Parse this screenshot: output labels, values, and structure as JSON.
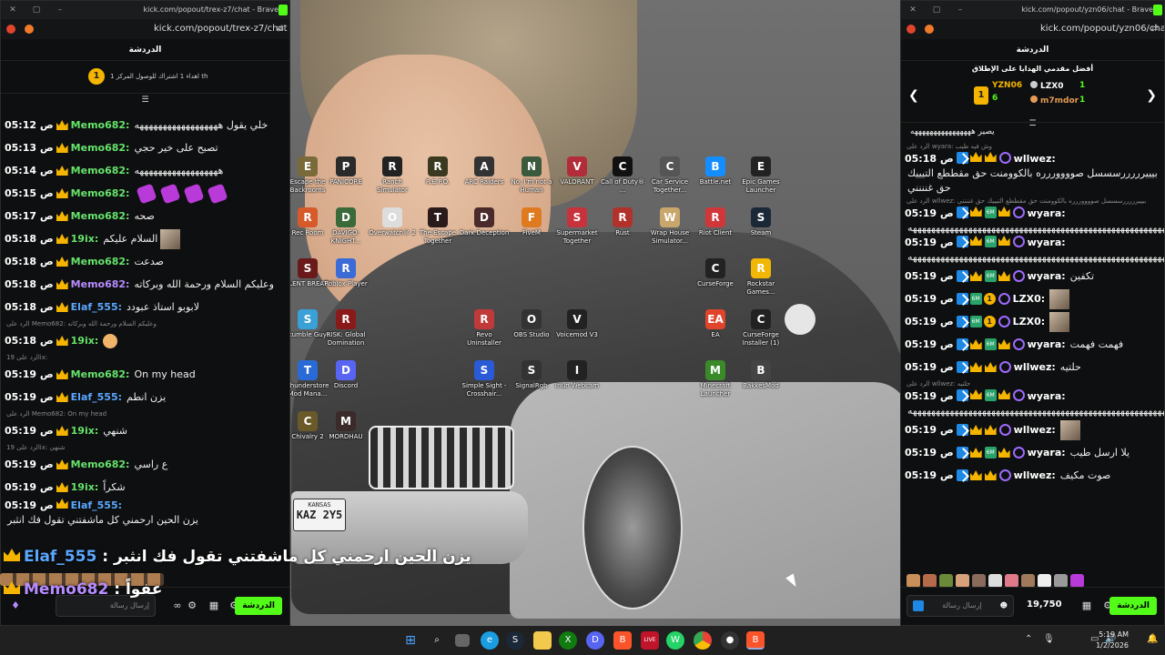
{
  "desktop": {
    "plate_state": "KANSAS",
    "plate_number": "KAZ 2Y5",
    "icons": [
      {
        "label": "Escape the Backrooms",
        "color": "#7a6a3a",
        "glyph": "E"
      },
      {
        "label": "PANICORE",
        "color": "#2a2a2a",
        "glyph": "P"
      },
      {
        "label": "Ranch Simulator",
        "color": "#222",
        "glyph": "R"
      },
      {
        "label": "R.E.P.O.",
        "color": "#3a3a20",
        "glyph": "R"
      },
      {
        "label": "ARC Raiders",
        "color": "#333",
        "glyph": "A"
      },
      {
        "label": "No, I'm not a Human",
        "color": "#3b5a3b",
        "glyph": "N"
      },
      {
        "label": "VALORANT",
        "color": "#b22d3a",
        "glyph": "V"
      },
      {
        "label": "Call of Duty® ...",
        "color": "#111",
        "glyph": "C"
      },
      {
        "label": "Car Service Together...",
        "color": "#555",
        "glyph": "C"
      },
      {
        "label": "Battle.net",
        "color": "#148eff",
        "glyph": "B"
      },
      {
        "label": "Epic Games Launcher",
        "color": "#222",
        "glyph": "E"
      },
      {
        "label": "Rec Room",
        "color": "#d65a2a",
        "glyph": "R"
      },
      {
        "label": "DAVIGO: KNIGHT...",
        "color": "#3a6a3a",
        "glyph": "D"
      },
      {
        "label": "Overwatch® 2",
        "color": "#ddd",
        "glyph": "O"
      },
      {
        "label": "The Escape Together",
        "color": "#2a1a1a",
        "glyph": "T"
      },
      {
        "label": "Dark Deception",
        "color": "#4a2a2a",
        "glyph": "D"
      },
      {
        "label": "FiveM",
        "color": "#e07a20",
        "glyph": "F"
      },
      {
        "label": "Supermarket Together",
        "color": "#c8323c",
        "glyph": "S"
      },
      {
        "label": "Rust",
        "color": "#b0322a",
        "glyph": "R"
      },
      {
        "label": "Wrap House Simulator...",
        "color": "#c9a66b",
        "glyph": "W"
      },
      {
        "label": "Riot Client",
        "color": "#d13639",
        "glyph": "R"
      },
      {
        "label": "Steam",
        "color": "#1b2838",
        "glyph": "S"
      },
      {
        "label": "SILENT BREATH",
        "color": "#6a1a1a",
        "glyph": "S"
      },
      {
        "label": "Roblox Player",
        "color": "#3a6bd6",
        "glyph": "R"
      },
      {
        "label": "CurseForge",
        "color": "#222",
        "glyph": "C"
      },
      {
        "label": "Rockstar Games...",
        "color": "#f2b705",
        "glyph": "R"
      },
      {
        "label": "Stumble Guys",
        "color": "#3aa0d6",
        "glyph": "S"
      },
      {
        "label": "RISK: Global Domination",
        "color": "#8a1a1a",
        "glyph": "R"
      },
      {
        "label": "Revo Uninstaller",
        "color": "#c13a3a",
        "glyph": "R"
      },
      {
        "label": "OBS Studio",
        "color": "#333",
        "glyph": "O"
      },
      {
        "label": "Voicemod V3",
        "color": "#222",
        "glyph": "V"
      },
      {
        "label": "EA",
        "color": "#e0442a",
        "glyph": "EA"
      },
      {
        "label": "CurseForge Installer (1)",
        "color": "#222",
        "glyph": "C"
      },
      {
        "label": "Thunderstore Mod Mana...",
        "color": "#2a6ad6",
        "glyph": "T"
      },
      {
        "label": "Discord",
        "color": "#5865f2",
        "glyph": "D"
      },
      {
        "label": "Simple Sight - Crosshair...",
        "color": "#2a5ad6",
        "glyph": "S"
      },
      {
        "label": "SignalRgb",
        "color": "#333",
        "glyph": "S"
      },
      {
        "label": "Iriun Webcam",
        "color": "#222",
        "glyph": "I"
      },
      {
        "label": "Minecraft Launcher",
        "color": "#3a8a2a",
        "glyph": "M"
      },
      {
        "label": "BakkesMod",
        "color": "#444",
        "glyph": "B"
      },
      {
        "label": "Chivalry 2",
        "color": "#6a5a2a",
        "glyph": "C"
      },
      {
        "label": "MORDHAU",
        "color": "#3a2a2a",
        "glyph": "M"
      }
    ]
  },
  "left_window": {
    "title": "kick.com/popout/trex-z7/chat - Brave",
    "url": "kick.com/popout/trex-z7/chat",
    "chat_header": "الدردشة",
    "goal_text": "اهداء 1 اشتراك للوصول المركز 1 th",
    "goal_rank": "1",
    "messages": [
      {
        "time": "05:12 ص",
        "user": "Memo682",
        "text": "خلي يقول ههههههههههههههههههه",
        "color": "memo"
      },
      {
        "time": "05:13 ص",
        "user": "Memo682",
        "text": "تصبح على خير حجي",
        "color": "memo"
      },
      {
        "time": "05:14 ص",
        "user": "Memo682",
        "text": "ههههههههههههههههههه",
        "color": "memo"
      },
      {
        "time": "05:15 ص",
        "user": "Memo682",
        "text": "",
        "color": "memo",
        "emotes": 4
      },
      {
        "time": "05:17 ص",
        "user": "Memo682",
        "text": "صحه",
        "color": "memo"
      },
      {
        "time": "05:18 ص",
        "user": "19ix",
        "text": "السلام عليكم",
        "color": "19ix",
        "avatar": true
      },
      {
        "time": "05:18 ص",
        "user": "Memo682",
        "text": "صدعت",
        "color": "memo"
      },
      {
        "time": "05:18 ص",
        "user": "Memo682",
        "text": "وعليكم السلام ورحمة الله وبركاته",
        "color": "memo-purple"
      },
      {
        "time": "05:18 ص",
        "user": "Elaf_555",
        "text": "لابوبو استاذ عبودد",
        "color": "elaf"
      },
      {
        "reply": "الرد على Memo682: وعليكم السلام ورحمة الله وبركاته"
      },
      {
        "time": "05:18 ص",
        "user": "19ix",
        "text": "",
        "color": "19ix",
        "face": true
      },
      {
        "reply": "الرد على 19ix:"
      },
      {
        "time": "05:19 ص",
        "user": "Memo682",
        "text": "On my head",
        "color": "memo"
      },
      {
        "time": "05:19 ص",
        "user": "Elaf_555",
        "text": "يزن انطم",
        "color": "elaf"
      },
      {
        "reply": "الرد على Memo682: On my head"
      },
      {
        "time": "05:19 ص",
        "user": "19ix",
        "text": "شنهي",
        "color": "19ix"
      },
      {
        "reply": "الرد على 19ix: شنهي"
      },
      {
        "time": "05:19 ص",
        "user": "Memo682",
        "text": "ع راسي",
        "color": "memo"
      },
      {
        "time": "05:19 ص",
        "user": "19ix",
        "text": "شكراً",
        "color": "19ix"
      },
      {
        "time": "05:19 ص",
        "user": "Elaf_555",
        "text": "يزن الحين ارحمني كل ماشفتني تقول فك انثبر",
        "color": "elaf",
        "wrap": true
      }
    ],
    "overlay_line1_user": "Elaf_555",
    "overlay_line1_text": "يزن الحين ارحمني كل ماشفتني تقول فك انثبر",
    "overlay_line2_user": "Memo682",
    "overlay_line2_text": "عفواً",
    "input_placeholder": "إرسال رسالة",
    "send_label": "الدردشة"
  },
  "right_window": {
    "title": "kick.com/popout/yzn06/chat - Brave",
    "url": "kick.com/popout/yzn06/chat",
    "chat_header": "الدردشة",
    "gifters_title": "أفضل مقدمي الهدايا على الإطلاق",
    "gifters": [
      {
        "name": "YZN06",
        "count": "6"
      },
      {
        "name": "LZX0",
        "count": "1"
      },
      {
        "name": "m7mdor",
        "count": "1"
      }
    ],
    "pinned_text": "يصير ههههههههههههههههه",
    "messages": [
      {
        "reply": "الرد على wyara: وش فيه طيب"
      },
      {
        "time": "05:18 ص",
        "user": "wllwez",
        "text": "بيييرررررسسسل صووووررره بالكوومنت حق مقططع التيييك حق غنننني",
        "wrap": true,
        "badges": "bcc"
      },
      {
        "reply": "الرد على wllwez: بيييرررررسسسل صووووررره بالكوومنت حق مقططع التيييك حق غنننني"
      },
      {
        "time": "05:19 ص",
        "user": "wyara",
        "text": "ههههههههههههههههههههههههههههههههههههههههههههههههههههههههههههههههههه",
        "wrap": true,
        "badges": "bcgc"
      },
      {
        "time": "05:19 ص",
        "user": "wyara",
        "text": "ههههههههههههههههههههههههههههههههههههههههههههههههههههههههههه",
        "wrap": true,
        "badges": "bcgc"
      },
      {
        "time": "05:19 ص",
        "user": "wyara",
        "text": "تكفين",
        "badges": "bcgc"
      },
      {
        "time": "05:19 ص",
        "user": "LZX0",
        "text": "",
        "avatar": true,
        "badges": "bgo"
      },
      {
        "time": "05:19 ص",
        "user": "LZX0",
        "text": "",
        "avatar": true,
        "badges": "bgo"
      },
      {
        "time": "05:19 ص",
        "user": "wyara",
        "text": "فهمت فهمت",
        "badges": "bcgc"
      },
      {
        "time": "05:19 ص",
        "user": "wllwez",
        "text": "حلتيه",
        "badges": "bcc"
      },
      {
        "reply": "الرد على wllwez: حلتيه"
      },
      {
        "time": "05:19 ص",
        "user": "wyara",
        "text": "ههههههههههههههههههههههههههههههههههههههههههههههههههههههههه",
        "wrap": true,
        "badges": "bcgc"
      },
      {
        "time": "05:19 ص",
        "user": "wllwez",
        "text": "",
        "avatar": true,
        "badges": "bcc"
      },
      {
        "time": "05:19 ص",
        "user": "wyara",
        "text": "يلا ارسل طيب",
        "badges": "bcgc"
      },
      {
        "time": "05:19 ص",
        "user": "wllwez",
        "text": "صوت مكيف",
        "badges": "bcc"
      }
    ],
    "input_placeholder": "إرسال رسالة",
    "points": "19,750",
    "send_label": "الدردشة"
  },
  "taskbar": {
    "clock_time": "5:19 AM",
    "clock_date": "1/2/2026",
    "apps": [
      "windows-start",
      "search",
      "task-view",
      "edge",
      "steam",
      "file-explorer",
      "xbox",
      "discord",
      "brave",
      "tiktok",
      "whatsapp",
      "chrome",
      "obs",
      "brave-active"
    ]
  }
}
